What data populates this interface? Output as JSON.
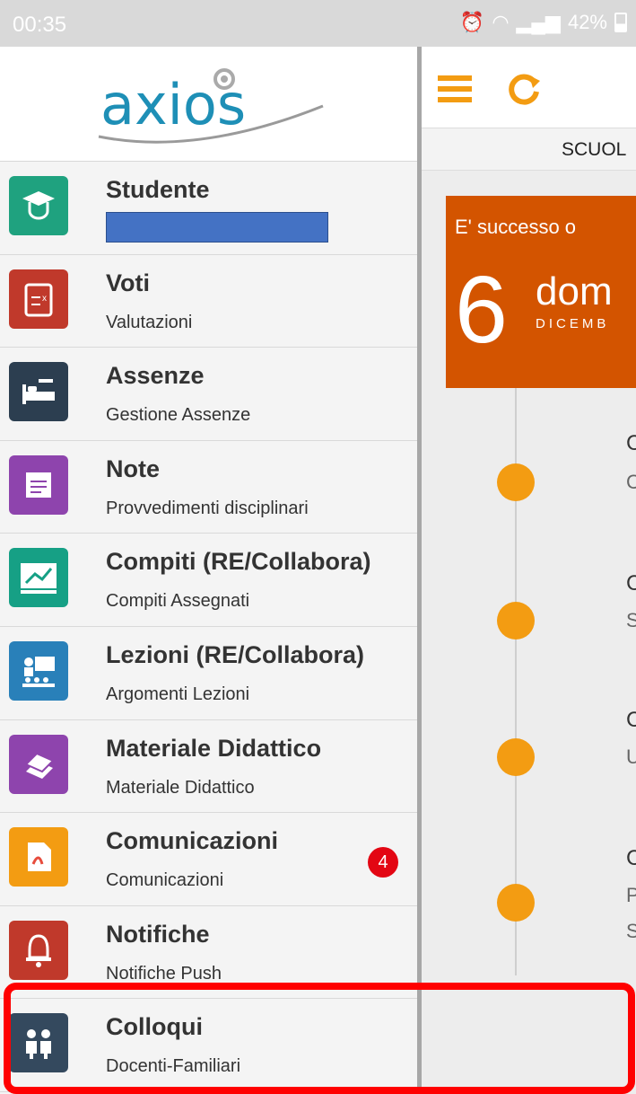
{
  "status_bar": {
    "time": "00:35",
    "battery": "42%"
  },
  "app": {
    "logo_text": "axios"
  },
  "menu": [
    {
      "title": "Studente",
      "subtitle": "",
      "icon": "graduate-icon",
      "color": "#1fa27f"
    },
    {
      "title": "Voti",
      "subtitle": "Valutazioni",
      "icon": "clipboard-icon",
      "color": "#c0392b"
    },
    {
      "title": "Assenze",
      "subtitle": "Gestione Assenze",
      "icon": "bed-icon",
      "color": "#2c3e50"
    },
    {
      "title": "Note",
      "subtitle": "Provvedimenti disciplinari",
      "icon": "note-icon",
      "color": "#8e44ad"
    },
    {
      "title": "Compiti (RE/Collabora)",
      "subtitle": "Compiti Assegnati",
      "icon": "chart-board-icon",
      "color": "#16a085"
    },
    {
      "title": "Lezioni (RE/Collabora)",
      "subtitle": "Argomenti Lezioni",
      "icon": "teacher-icon",
      "color": "#2980b9"
    },
    {
      "title": "Materiale Didattico",
      "subtitle": "Materiale Didattico",
      "icon": "books-icon",
      "color": "#8e44ad"
    },
    {
      "title": "Comunicazioni",
      "subtitle": "Comunicazioni",
      "icon": "pdf-icon",
      "color": "#f39c12",
      "badge": "4"
    },
    {
      "title": "Notifiche",
      "subtitle": "Notifiche Push",
      "icon": "bell-icon",
      "color": "#c0392b"
    },
    {
      "title": "Colloqui",
      "subtitle": "Docenti-Familiari",
      "icon": "meeting-icon",
      "color": "#34495e"
    }
  ],
  "content": {
    "subbar_label": "SCUOL",
    "card": {
      "banner": "E' successo o",
      "day": "6",
      "weekday": "dom",
      "month": "DICEMB"
    },
    "entries": [
      {
        "line1": "C",
        "line2": "C"
      },
      {
        "line1": "C",
        "line2": "S"
      },
      {
        "line1": "C",
        "line2": "U"
      },
      {
        "line1": "C",
        "line2": "P",
        "line3": "S"
      }
    ]
  },
  "colors": {
    "accent": "#f39c12",
    "card": "#d35400",
    "highlight": "#ff0000",
    "badge": "#e30613"
  }
}
